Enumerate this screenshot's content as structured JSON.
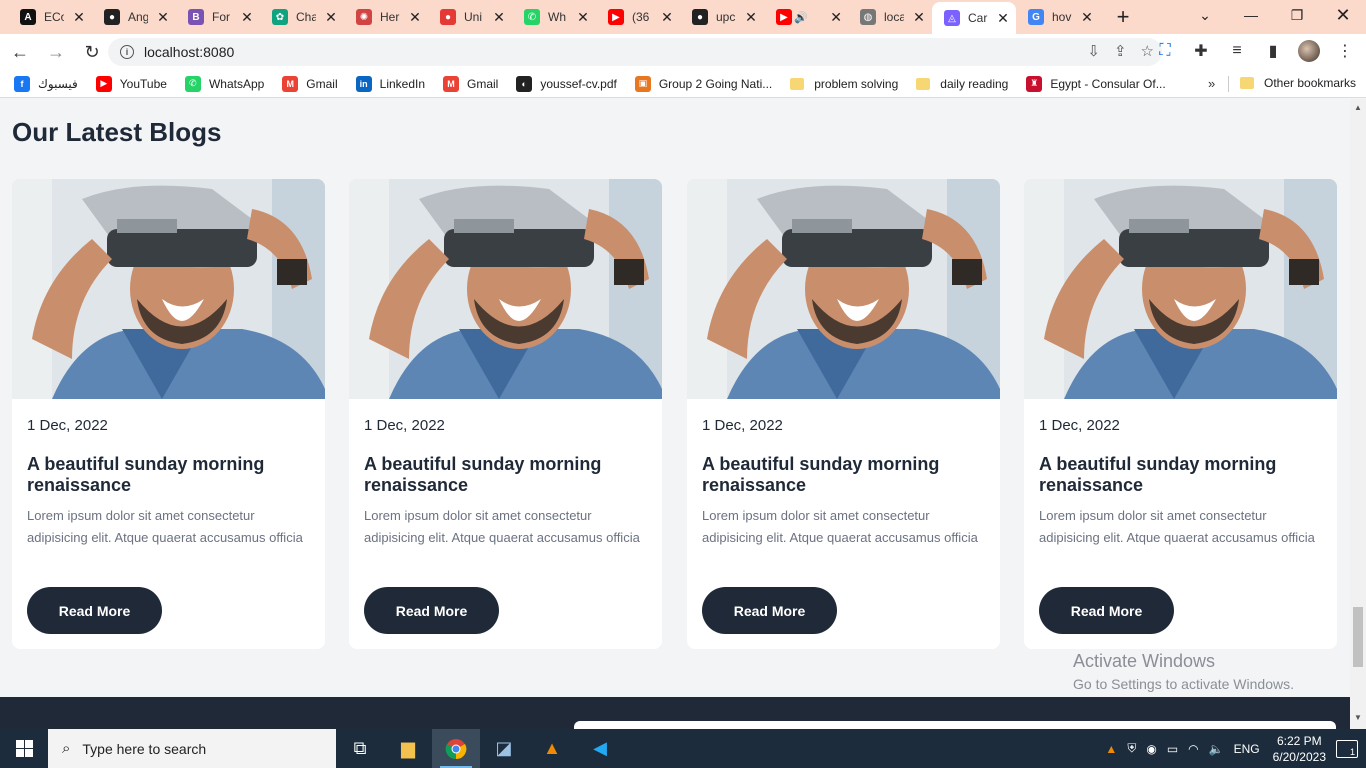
{
  "browser": {
    "tabs": [
      {
        "label": "ECo",
        "icon": "a-logo-icon",
        "color": "#111111",
        "glyph": "A"
      },
      {
        "label": "Ang",
        "icon": "github-icon",
        "color": "#222222",
        "glyph": "●"
      },
      {
        "label": "For",
        "icon": "bootstrap-icon",
        "color": "#7952b3",
        "glyph": "B"
      },
      {
        "label": "Cha",
        "icon": "chatgpt-icon",
        "color": "#10a37f",
        "glyph": "✿"
      },
      {
        "label": "Her",
        "icon": "hero-icon",
        "color": "#d04444",
        "glyph": "✺"
      },
      {
        "label": "Uni",
        "icon": "record-icon",
        "color": "#e53935",
        "glyph": "●"
      },
      {
        "label": "Wh",
        "icon": "whatsapp-icon",
        "color": "#25d366",
        "glyph": "✆"
      },
      {
        "label": "(36",
        "icon": "youtube-icon",
        "color": "#ff0000",
        "glyph": "▶"
      },
      {
        "label": "upc",
        "icon": "github-icon",
        "color": "#222222",
        "glyph": "●"
      },
      {
        "label": "",
        "icon": "youtube-icon",
        "color": "#ff0000",
        "glyph": "▶",
        "muted": "🔊"
      },
      {
        "label": "loca",
        "icon": "globe-icon",
        "color": "#777777",
        "glyph": "◍"
      },
      {
        "label": "Car",
        "icon": "app-icon",
        "color": "#7b61ff",
        "glyph": "◬",
        "active": true
      },
      {
        "label": "hov",
        "icon": "google-icon",
        "color": "#4285f4",
        "glyph": "G"
      }
    ],
    "address": {
      "url": "localhost:8080"
    },
    "bookmarks": [
      {
        "label": "فيسبوك",
        "icon": "facebook-icon",
        "color": "#1877f2",
        "glyph": "f"
      },
      {
        "label": "YouTube",
        "icon": "youtube-icon",
        "color": "#ff0000",
        "glyph": "▶"
      },
      {
        "label": "WhatsApp",
        "icon": "whatsapp-icon",
        "color": "#25d366",
        "glyph": "✆"
      },
      {
        "label": "Gmail",
        "icon": "gmail-icon",
        "color": "#ea4335",
        "glyph": "M"
      },
      {
        "label": "LinkedIn",
        "icon": "linkedin-icon",
        "color": "#0a66c2",
        "glyph": "in"
      },
      {
        "label": "Gmail",
        "icon": "gmail-icon",
        "color": "#ea4335",
        "glyph": "M"
      },
      {
        "label": "youssef-cv.pdf",
        "icon": "pdf-icon",
        "color": "#222222",
        "glyph": "◐"
      },
      {
        "label": "Group 2 Going Nati...",
        "icon": "briefcase-icon",
        "color": "#e87722",
        "glyph": "▣"
      },
      {
        "label": "problem solving",
        "icon": "folder-icon",
        "folder": true
      },
      {
        "label": "daily reading",
        "icon": "folder-icon",
        "folder": true
      },
      {
        "label": "Egypt - Consular Of...",
        "icon": "egypt-flag-icon",
        "color": "#c8102e",
        "glyph": "♜"
      }
    ],
    "more_bookmarks": "»",
    "other_bookmarks": "Other bookmarks"
  },
  "page": {
    "title": "Our Latest Blogs",
    "cards": [
      {
        "date": "1 Dec, 2022",
        "title": "A beautiful sunday morning renaissance",
        "desc": "Lorem ipsum dolor sit amet consectetur adipisicing elit. Atque quaerat accusamus officia",
        "button": "Read More"
      },
      {
        "date": "1 Dec, 2022",
        "title": "A beautiful sunday morning renaissance",
        "desc": "Lorem ipsum dolor sit amet consectetur adipisicing elit. Atque quaerat accusamus officia",
        "button": "Read More"
      },
      {
        "date": "1 Dec, 2022",
        "title": "A beautiful sunday morning renaissance",
        "desc": "Lorem ipsum dolor sit amet consectetur adipisicing elit. Atque quaerat accusamus officia",
        "button": "Read More"
      },
      {
        "date": "1 Dec, 2022",
        "title": "A beautiful sunday morning renaissance",
        "desc": "Lorem ipsum dolor sit amet consectetur adipisicing elit. Atque quaerat accusamus officia",
        "button": "Read More"
      }
    ]
  },
  "watermark": {
    "line1": "Activate Windows",
    "line2": "Go to Settings to activate Windows."
  },
  "taskbar": {
    "search_placeholder": "Type here to search",
    "language": "ENG",
    "time": "6:22 PM",
    "date": "6/20/2023",
    "notifications": "1"
  },
  "colors": {
    "accent": "#1f2937",
    "tabstrip": "#fbd9cb",
    "taskbar": "#1c2c3c"
  }
}
